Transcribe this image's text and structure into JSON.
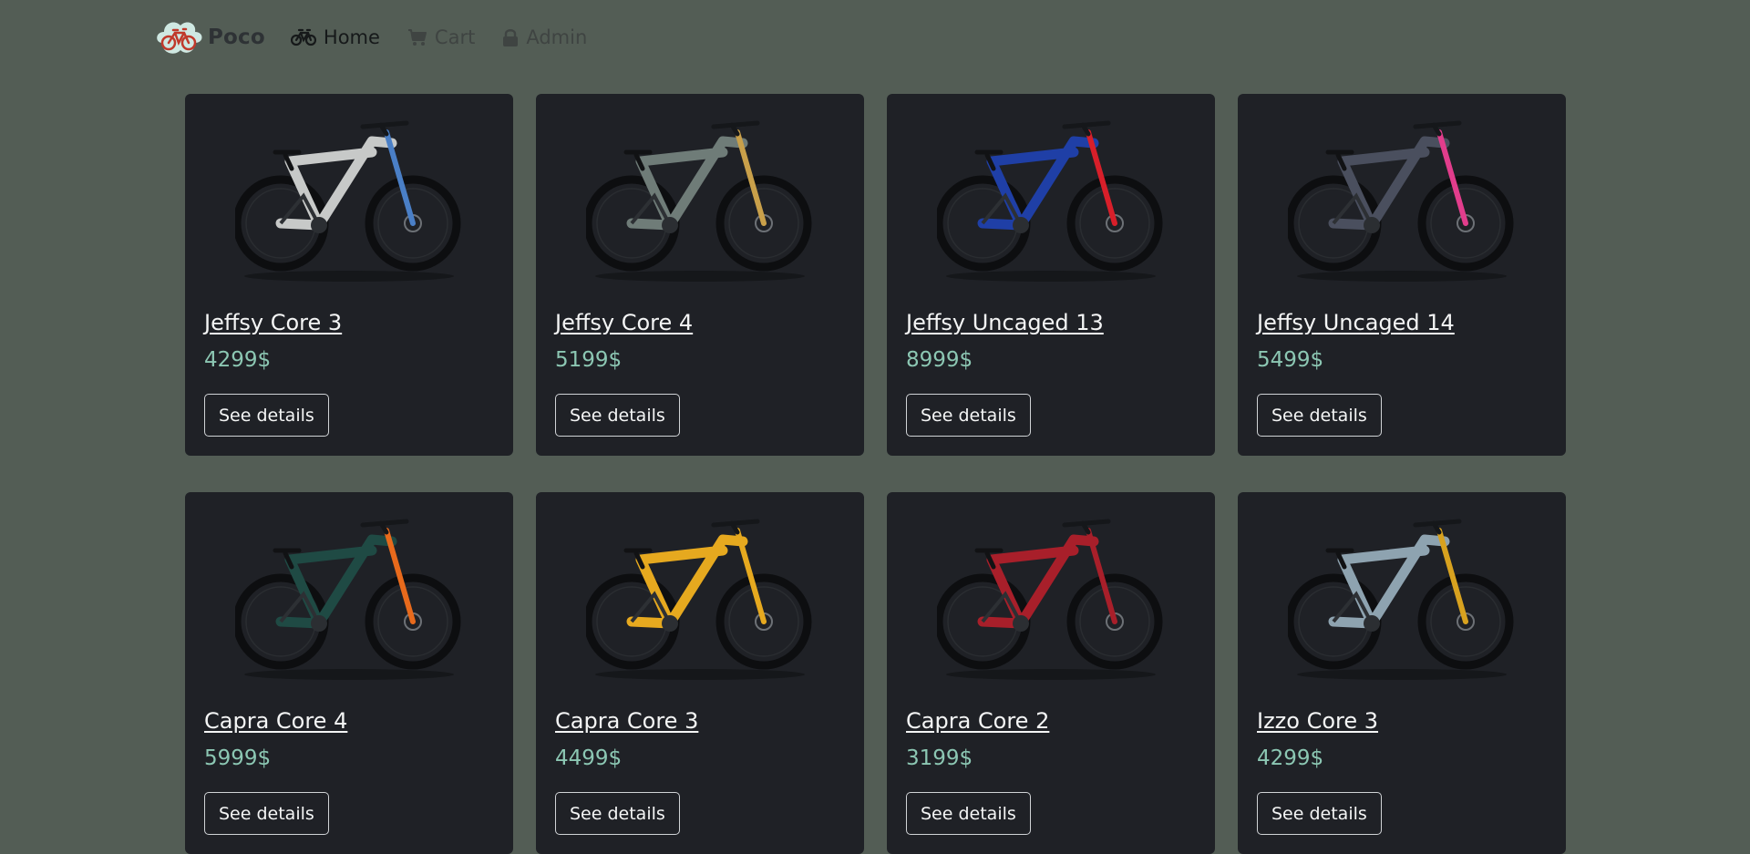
{
  "brand": {
    "name": "Poco",
    "logo_icon": "bike-logo-icon"
  },
  "nav": [
    {
      "label": "Home",
      "icon": "bicycle-icon",
      "active": true
    },
    {
      "label": "Cart",
      "icon": "cart-icon",
      "active": false
    },
    {
      "label": "Admin",
      "icon": "lock-icon",
      "active": false
    }
  ],
  "colors": {
    "background": "#535d55",
    "card": "#1f2126",
    "price": "#8cc7b3"
  },
  "products": [
    {
      "name": "Jeffsy Core 3",
      "price": "4299$",
      "button": "See details",
      "frame_color": "#c7c9c8",
      "accent": "#4a7fc6"
    },
    {
      "name": "Jeffsy Core 4",
      "price": "5199$",
      "button": "See details",
      "frame_color": "#6f7c78",
      "accent": "#c9a04a"
    },
    {
      "name": "Jeffsy Uncaged 13",
      "price": "8999$",
      "button": "See details",
      "frame_color": "#1f3fa6",
      "accent": "#d81f2a"
    },
    {
      "name": "Jeffsy Uncaged 14",
      "price": "5499$",
      "button": "See details",
      "frame_color": "#4a4f5e",
      "accent": "#e23d8c"
    },
    {
      "name": "Capra Core 4",
      "price": "5999$",
      "button": "See details",
      "frame_color": "#1f4a44",
      "accent": "#e86a1c"
    },
    {
      "name": "Capra Core 3",
      "price": "4499$",
      "button": "See details",
      "frame_color": "#e6a91f",
      "accent": "#e6a91f"
    },
    {
      "name": "Capra Core 2",
      "price": "3199$",
      "button": "See details",
      "frame_color": "#a81f2a",
      "accent": "#a81f2a"
    },
    {
      "name": "Izzo Core 3",
      "price": "4299$",
      "button": "See details",
      "frame_color": "#8ea3b0",
      "accent": "#d8a21f"
    }
  ]
}
